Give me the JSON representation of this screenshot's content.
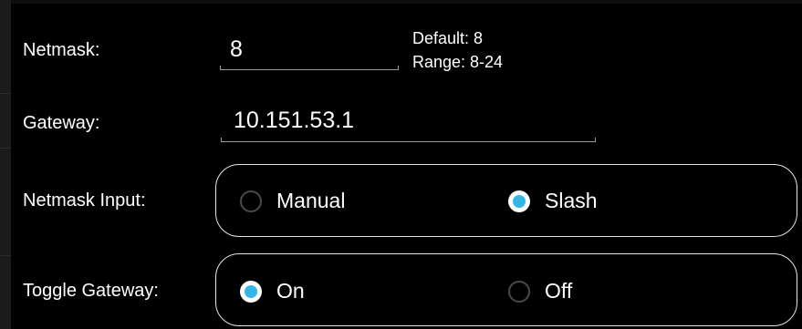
{
  "netmask": {
    "label": "Netmask:",
    "value": "8",
    "hint_default": "Default: 8",
    "hint_range": "Range: 8-24"
  },
  "gateway": {
    "label": "Gateway:",
    "value": "10.151.53.1"
  },
  "netmask_input": {
    "label": "Netmask Input:",
    "options": [
      {
        "label": "Manual",
        "selected": false
      },
      {
        "label": "Slash",
        "selected": true
      }
    ]
  },
  "toggle_gateway": {
    "label": "Toggle Gateway:",
    "options": [
      {
        "label": "On",
        "selected": true
      },
      {
        "label": "Off",
        "selected": false
      }
    ]
  },
  "colors": {
    "accent": "#33b5e5",
    "background": "#000000",
    "text": "#ffffff"
  }
}
